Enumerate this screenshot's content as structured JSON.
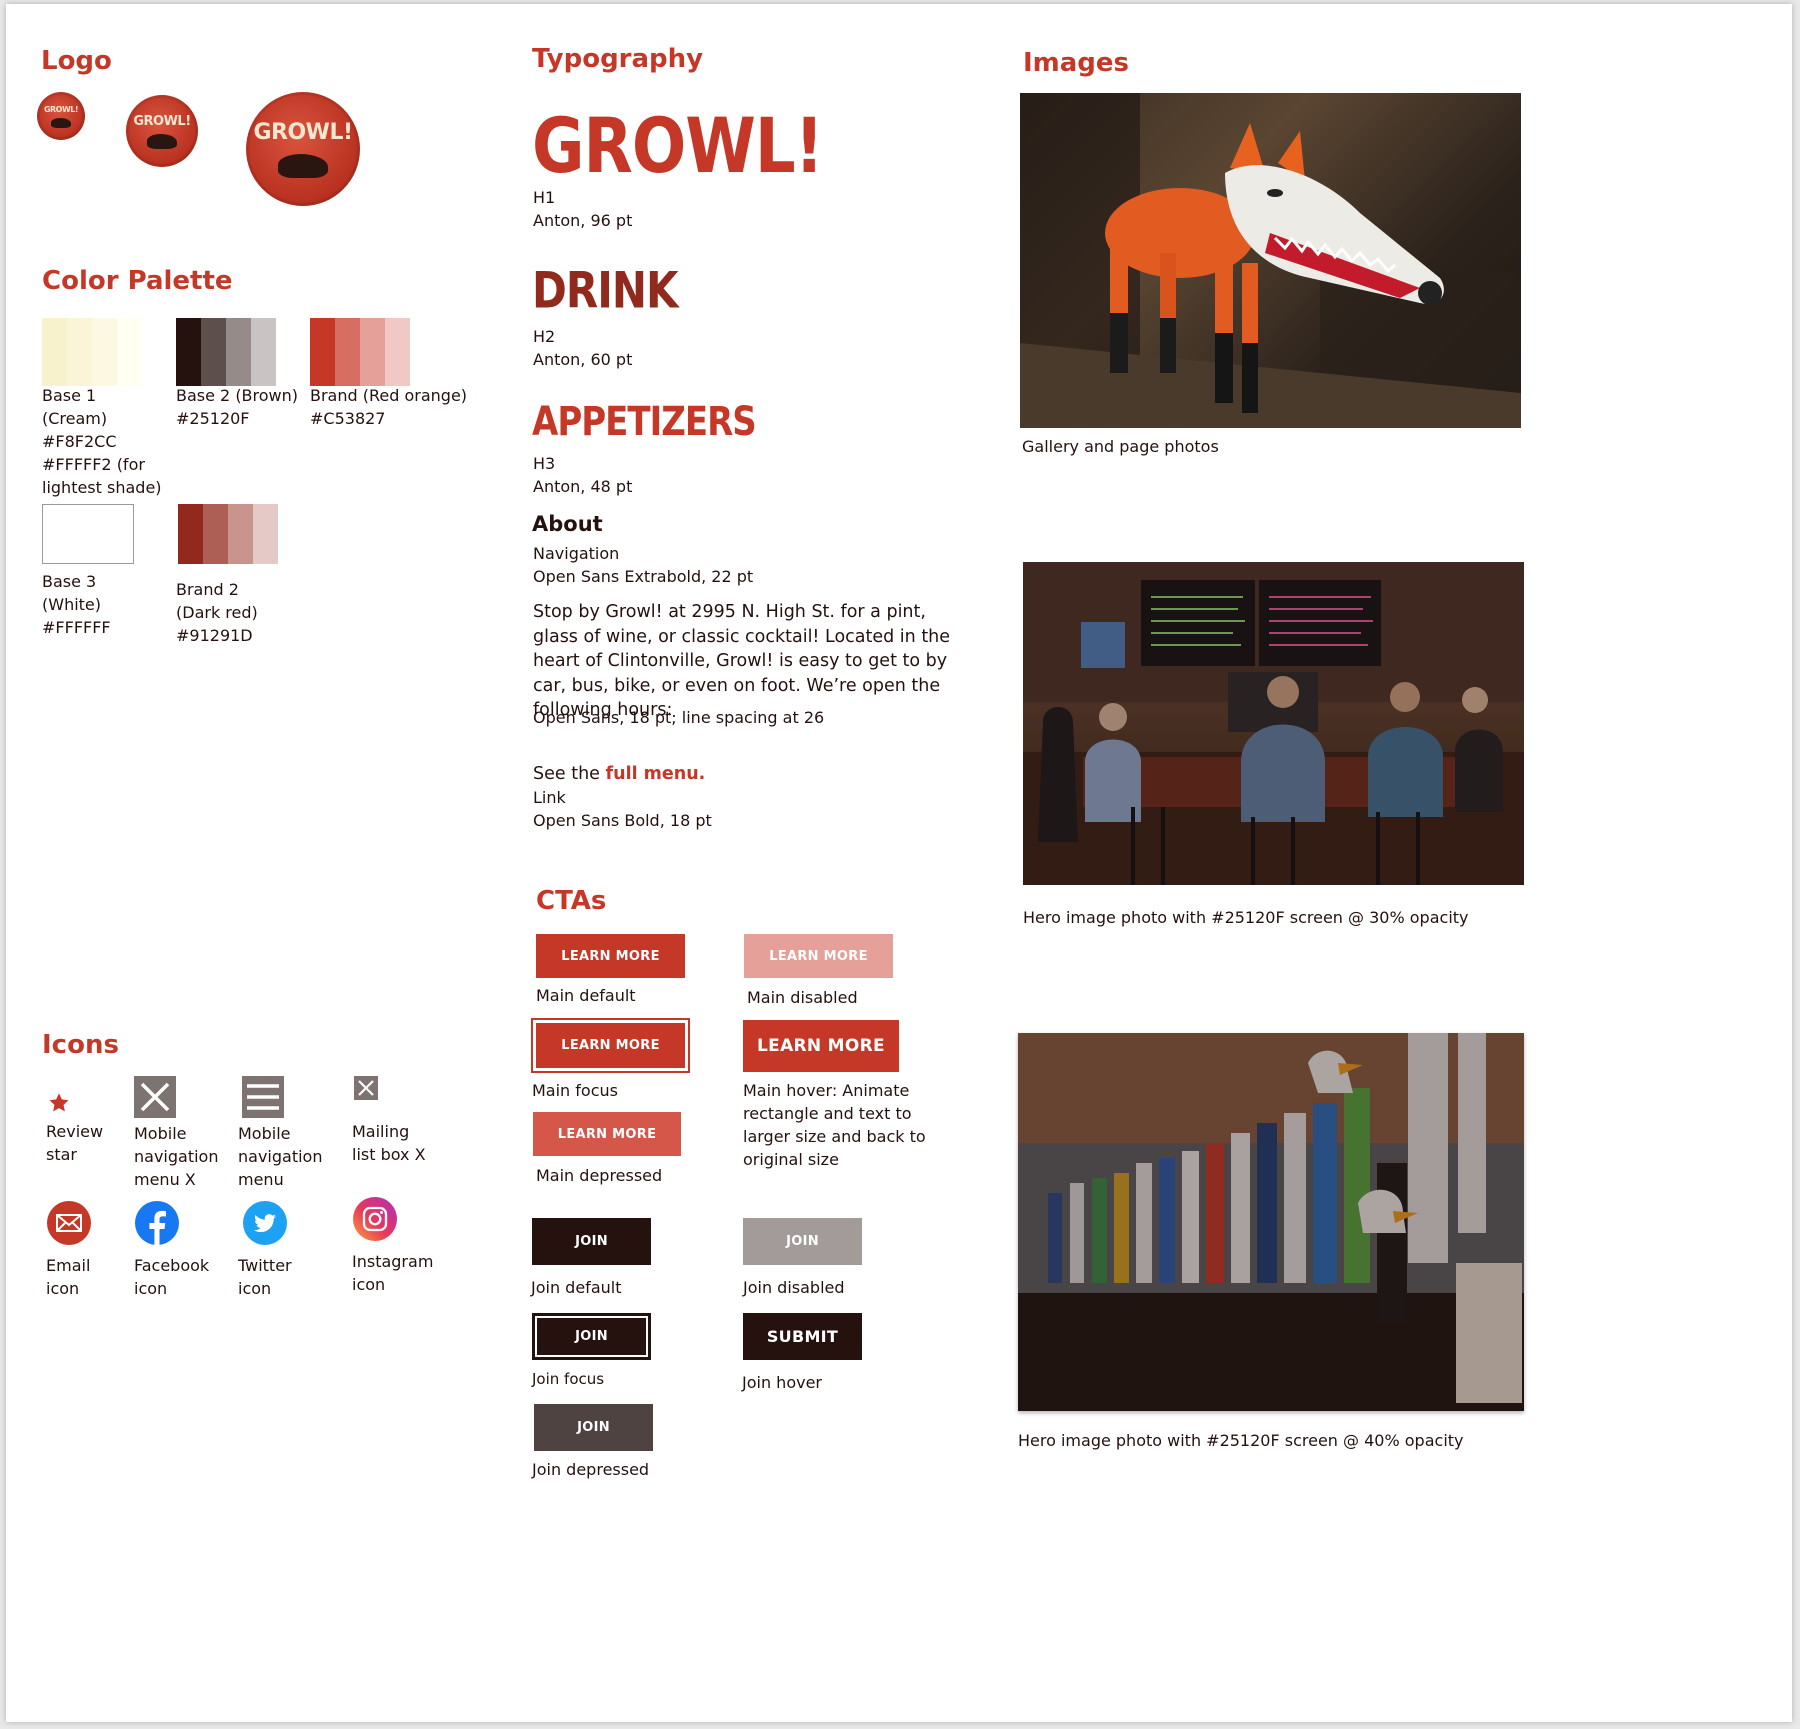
{
  "colors": {
    "base1": "#F8F2CC",
    "base2": "#25120F",
    "brand": "#C53827",
    "base3": "#FFFFFF",
    "brand2": "#91291D"
  },
  "logo": {
    "title": "Logo",
    "wordmark": "GROWL!"
  },
  "palette": {
    "title": "Color Palette",
    "base1": [
      "Base 1",
      "(Cream)",
      "#F8F2CC",
      "#FFFFF2 (for",
      "lightest shade)"
    ],
    "base2": [
      "Base 2 (Brown)",
      "#25120F"
    ],
    "brand": [
      "Brand (Red orange)",
      "#C53827"
    ],
    "base3": [
      "Base 3",
      "(White)",
      "#FFFFFF"
    ],
    "brand2": [
      "Brand 2",
      "(Dark red)",
      "#91291D"
    ]
  },
  "icons": {
    "title": "Icons",
    "review_star": [
      "Review",
      "star"
    ],
    "menu_x": [
      "Mobile",
      "navigation",
      "menu X"
    ],
    "menu": [
      "Mobile",
      "navigation",
      "menu"
    ],
    "mailing_x": [
      "Mailing",
      "list box X"
    ],
    "email": [
      "Email",
      "icon"
    ],
    "facebook": [
      "Facebook",
      "icon"
    ],
    "twitter": [
      "Twitter",
      "icon"
    ],
    "instagram": [
      "Instagram",
      "icon"
    ]
  },
  "typography": {
    "title": "Typography",
    "h1_sample": "GROWL!",
    "h1_label": "H1",
    "h1_spec": "Anton, 96 pt",
    "h2_sample": "DRINK",
    "h2_label": "H2",
    "h2_spec": "Anton, 60 pt",
    "h3_sample": "APPETIZERS",
    "h3_label": "H3",
    "h3_spec": "Anton, 48 pt",
    "nav_sample": "About",
    "nav_label": "Navigation",
    "nav_spec": "Open Sans Extrabold, 22 pt",
    "body_sample": "Stop by Growl! at 2995 N. High St. for a pint, glass of wine, or classic cocktail! Located in the heart of Clintonville, Growl! is easy to get to by car, bus, bike, or even on foot. We’re open the following hours:",
    "body_spec": "Open Sans, 18 pt; line spacing at 26",
    "link_prefix": "See the ",
    "link_text": "full menu.",
    "link_label": "Link",
    "link_spec": "Open Sans Bold, 18 pt"
  },
  "ctas": {
    "title": "CTAs",
    "learn_more": "LEARN MORE",
    "join": "JOIN",
    "submit": "SUBMIT",
    "main_default": "Main default",
    "main_disabled": "Main disabled",
    "main_focus": "Main focus",
    "main_hover": [
      "Main hover: Animate",
      "rectangle and text to",
      "larger size and back to",
      "original size"
    ],
    "main_depressed": "Main depressed",
    "join_default": "Join default",
    "join_disabled": "Join disabled",
    "join_focus": "Join focus",
    "join_hover": "Join hover",
    "join_depressed": "Join depressed"
  },
  "images": {
    "title": "Images",
    "gallery_caption": "Gallery and page photos",
    "hero30_caption": "Hero image photo with #25120F screen @ 30% opacity",
    "hero40_caption": "Hero image photo with #25120F screen @ 40% opacity"
  }
}
